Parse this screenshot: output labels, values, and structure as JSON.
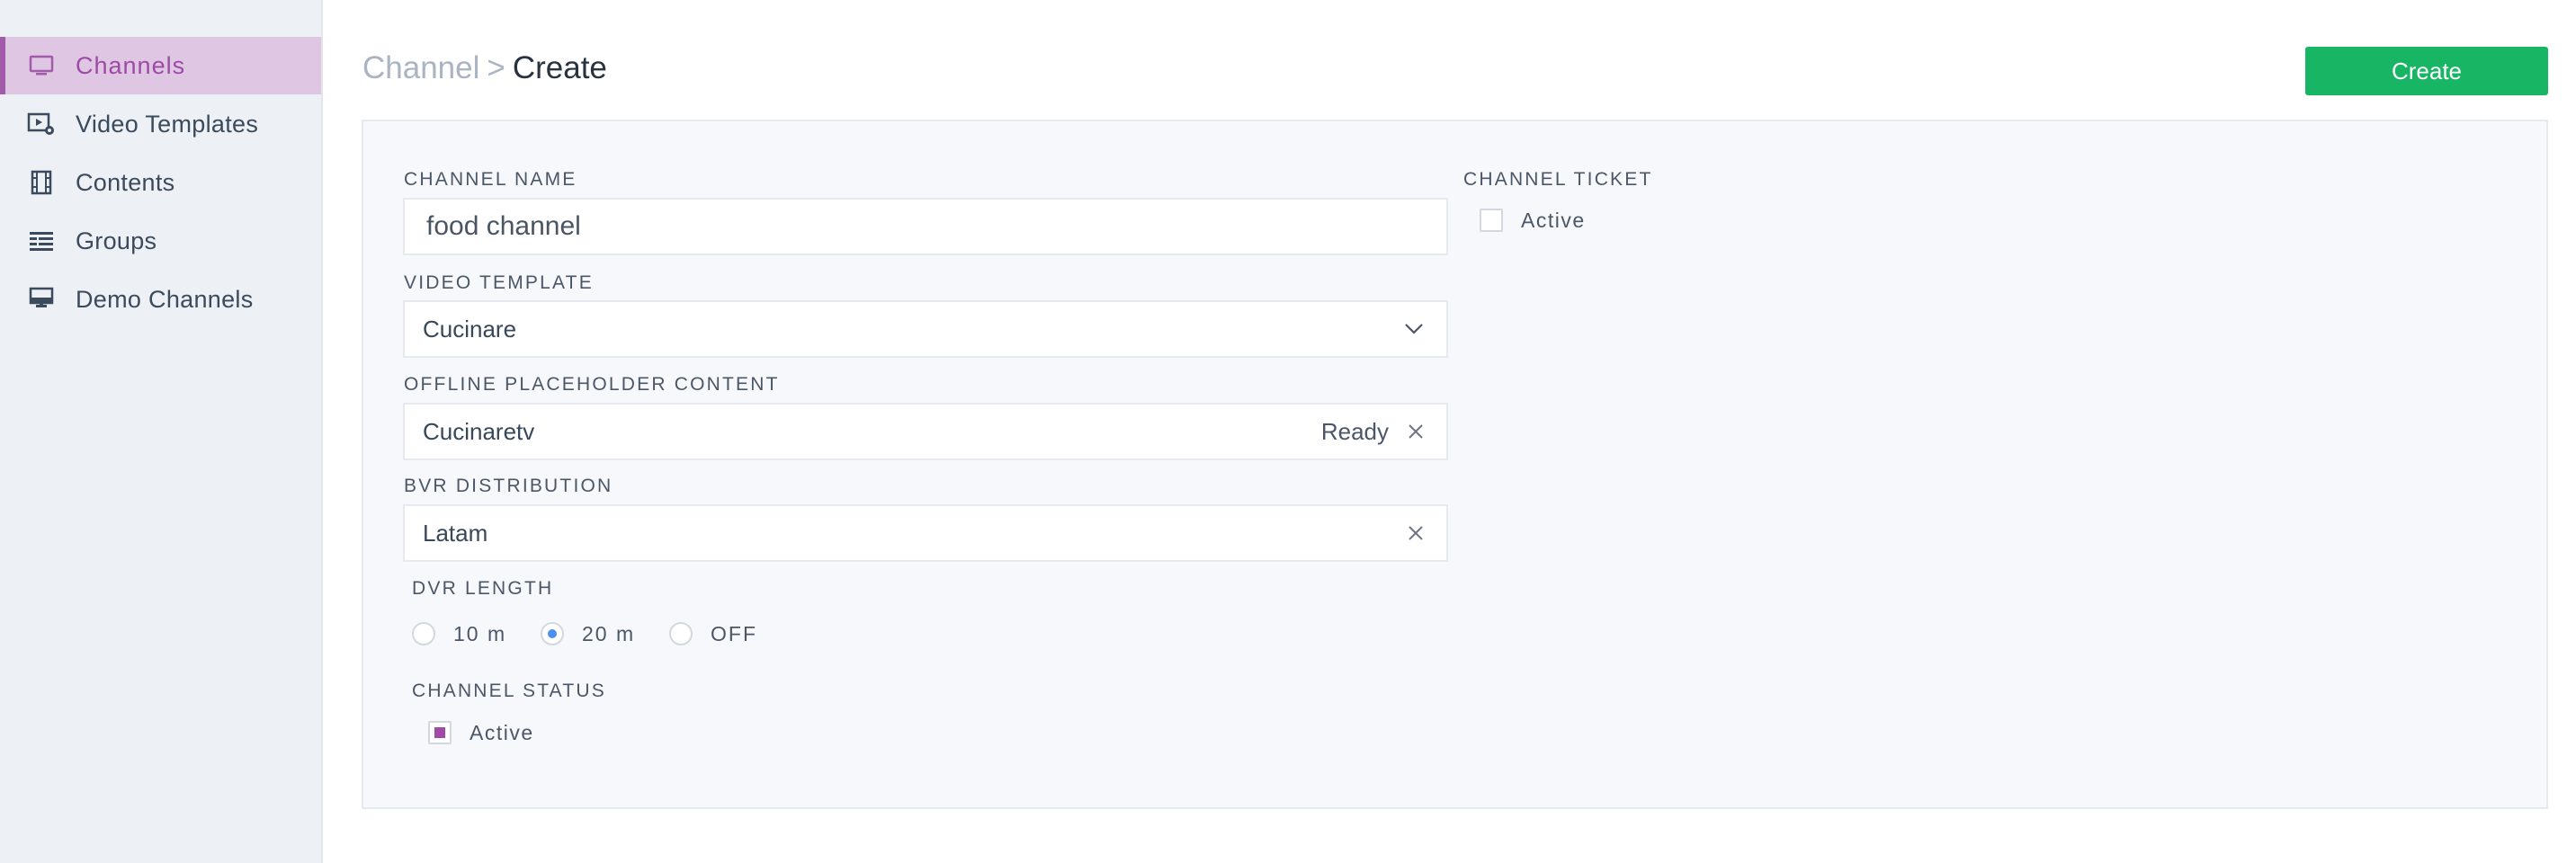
{
  "sidebar": {
    "items": [
      {
        "label": "Channels",
        "icon": "monitor-icon",
        "active": true
      },
      {
        "label": "Video Templates",
        "icon": "video-template-icon",
        "active": false
      },
      {
        "label": "Contents",
        "icon": "film-icon",
        "active": false
      },
      {
        "label": "Groups",
        "icon": "groups-icon",
        "active": false
      },
      {
        "label": "Demo Channels",
        "icon": "demo-monitor-icon",
        "active": false
      }
    ]
  },
  "header": {
    "breadcrumb_parent": "Channel",
    "breadcrumb_separator": ">",
    "breadcrumb_current": "Create",
    "create_label": "Create"
  },
  "form": {
    "channel_name": {
      "label": "CHANNEL NAME",
      "value": "food channel"
    },
    "video_template": {
      "label": "VIDEO TEMPLATE",
      "value": "Cucinare"
    },
    "offline_placeholder": {
      "label": "OFFLINE PLACEHOLDER CONTENT",
      "value": "Cucinaretv",
      "status": "Ready"
    },
    "bvr_distribution": {
      "label": "BVR DISTRIBUTION",
      "value": "Latam"
    },
    "dvr_length": {
      "label": "DVR LENGTH",
      "options": [
        "10 m",
        "20 m",
        "OFF"
      ],
      "selected": "20 m"
    },
    "channel_status": {
      "label": "CHANNEL STATUS",
      "option_label": "Active",
      "checked": true
    },
    "channel_ticket": {
      "label": "CHANNEL TICKET",
      "option_label": "Active",
      "checked": false
    }
  },
  "colors": {
    "accent": "#a25aaa",
    "primary_button": "#17b564",
    "radio_selected": "#4b8ff0"
  }
}
